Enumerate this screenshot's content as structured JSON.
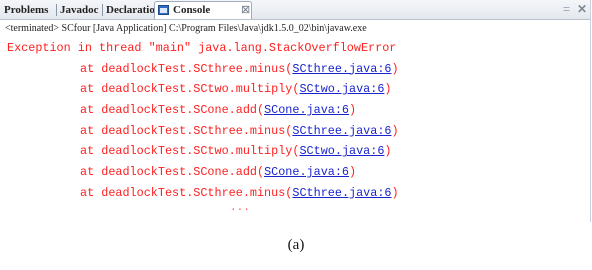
{
  "tabs": {
    "problems": "Problems",
    "javadoc": "Javadoc",
    "declaration": "Declaration",
    "console": "Console",
    "console_close": "⊠"
  },
  "toolbar": {
    "minimize": "=",
    "close": "✕"
  },
  "status": "<terminated> SCfour [Java Application] C:\\Program Files\\Java\\jdk1.5.0_02\\bin\\javaw.exe",
  "exception": "Exception in thread \"main\" java.lang.StackOverflowError",
  "frames": [
    {
      "method": "at deadlockTest.SCthree.minus(",
      "link": "SCthree.java:6",
      "close": ")"
    },
    {
      "method": "at deadlockTest.SCtwo.multiply(",
      "link": "SCtwo.java:6",
      "close": ")"
    },
    {
      "method": "at deadlockTest.SCone.add(",
      "link": "SCone.java:6",
      "close": ")"
    },
    {
      "method": "at deadlockTest.SCthree.minus(",
      "link": "SCthree.java:6",
      "close": ")"
    },
    {
      "method": "at deadlockTest.SCtwo.multiply(",
      "link": "SCtwo.java:6",
      "close": ")"
    },
    {
      "method": "at deadlockTest.SCone.add(",
      "link": "SCone.java:6",
      "close": ")"
    },
    {
      "method": "at deadlockTest.SCthree.minus(",
      "link": "SCthree.java:6",
      "close": ")"
    }
  ],
  "ellipsis": "...",
  "caption": "(a)"
}
